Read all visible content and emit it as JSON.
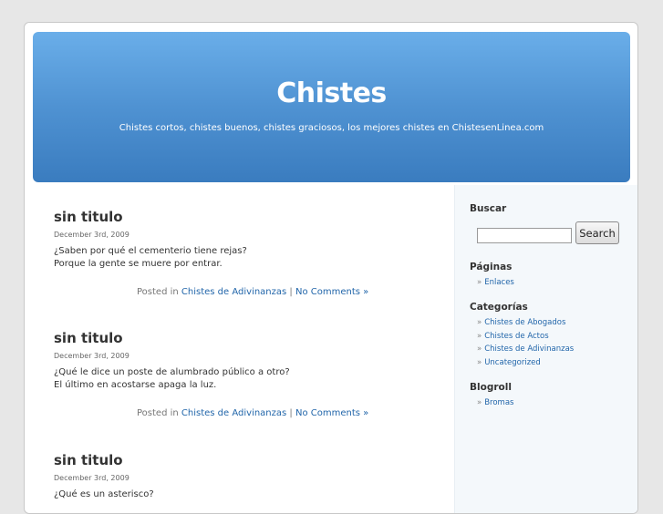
{
  "header": {
    "title": "Chistes",
    "description": "Chistes cortos, chistes buenos, chistes graciosos, los mejores chistes en ChistesenLinea.com"
  },
  "posts": [
    {
      "title": "sin titulo",
      "date": "December 3rd, 2009",
      "lines": [
        "¿Saben por qué el cementerio tiene rejas?",
        "Porque la gente se muere por entrar."
      ],
      "meta_prefix": "Posted in",
      "category": "Chistes de Adivinanzas",
      "separator": "|",
      "comments": "No Comments »"
    },
    {
      "title": "sin titulo",
      "date": "December 3rd, 2009",
      "lines": [
        "¿Qué le dice un poste de alumbrado público a otro?",
        "El último en acostarse apaga la luz."
      ],
      "meta_prefix": "Posted in",
      "category": "Chistes de Adivinanzas",
      "separator": "|",
      "comments": "No Comments »"
    },
    {
      "title": "sin titulo",
      "date": "December 3rd, 2009",
      "lines": [
        "¿Qué es un asterisco?"
      ]
    }
  ],
  "sidebar": {
    "search": {
      "heading": "Buscar",
      "button": "Search",
      "value": ""
    },
    "pages": {
      "heading": "Páginas",
      "items": [
        "Enlaces"
      ]
    },
    "categories": {
      "heading": "Categorías",
      "items": [
        "Chistes de Abogados",
        "Chistes de Actos",
        "Chistes de Adivinanzas",
        "Uncategorized"
      ]
    },
    "blogroll": {
      "heading": "Blogroll",
      "items": [
        "Bromas"
      ]
    }
  },
  "list_bullet": "»",
  "colors": {
    "header_top": "#6aaee9",
    "header_bottom": "#3a7cbf",
    "link": "#2266aa",
    "sidebar_bg": "#f4f8fb"
  }
}
